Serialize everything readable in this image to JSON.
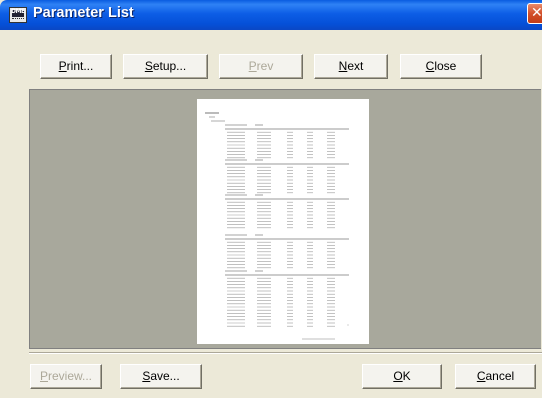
{
  "window": {
    "title": "Parameter List",
    "icon": "app-icon",
    "icon_text": "DME"
  },
  "toolbar": {
    "print_label": "Print...",
    "setup_label": "Setup...",
    "prev_label": "Prev",
    "next_label": "Next",
    "close_label": "Close"
  },
  "footer": {
    "preview_label": "Preview...",
    "save_label": "Save...",
    "ok_label": "OK",
    "cancel_label": "Cancel"
  },
  "colors": {
    "titlebar": "#0550d8",
    "close_button": "#d2502b",
    "dialog_bg": "#ece9d8",
    "preview_bg": "#a8a89c"
  }
}
